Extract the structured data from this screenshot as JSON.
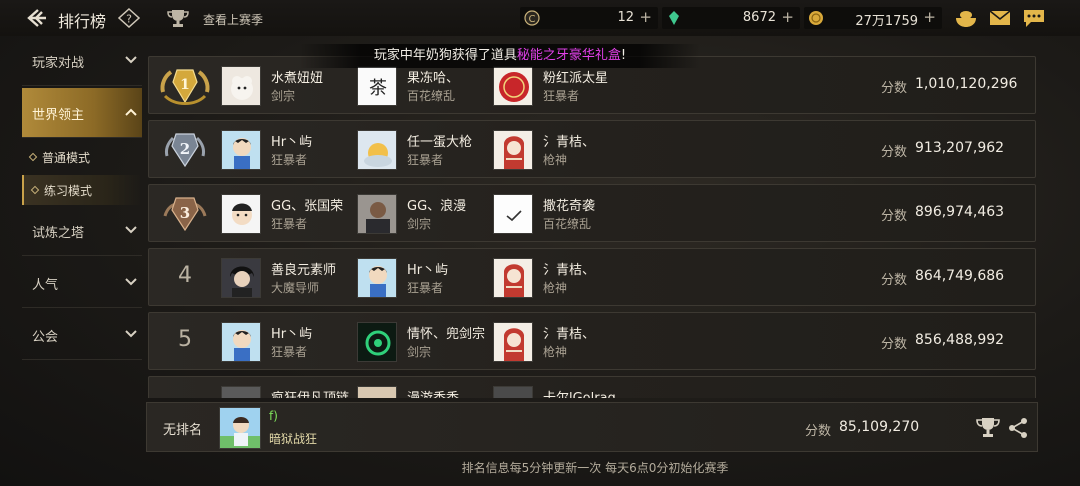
{
  "header": {
    "title": "排行榜",
    "prev_season": "查看上赛季",
    "currencies": [
      {
        "icon": "c-coin-icon",
        "value": "12",
        "color": "#c9b27a"
      },
      {
        "icon": "green-gem-icon",
        "value": "8672",
        "color": "#3fc88f"
      },
      {
        "icon": "gold-coin-icon",
        "value": "27万1759",
        "color": "#d9a93a"
      }
    ]
  },
  "sidebar": {
    "items": [
      {
        "label": "玩家对战"
      },
      {
        "label": "世界领主"
      },
      {
        "label": "试炼之塔"
      },
      {
        "label": "人气"
      },
      {
        "label": "公会"
      }
    ],
    "sub_items": [
      {
        "label": "普通模式"
      },
      {
        "label": "练习模式"
      }
    ]
  },
  "announcement": {
    "prefix": "玩家中年奶狗获得了道具",
    "item": "秘能之牙豪华礼盒",
    "suffix": "!",
    "item_color": "#e040e8"
  },
  "leaderboard": {
    "score_label": "分数",
    "rows": [
      {
        "rank": "1",
        "players": [
          {
            "name": "水煮妞妞",
            "class": "剑宗"
          },
          {
            "name": "果冻哈、",
            "class": "百花缭乱"
          },
          {
            "name": "粉红派太星",
            "class": "狂暴者"
          }
        ],
        "score": "1,010,120,296"
      },
      {
        "rank": "2",
        "players": [
          {
            "name": "Hr丶屿",
            "class": "狂暴者"
          },
          {
            "name": "任一蛋大枪",
            "class": "狂暴者"
          },
          {
            "name": "氵青桔、",
            "class": "枪神"
          }
        ],
        "score": "913,207,962"
      },
      {
        "rank": "3",
        "players": [
          {
            "name": "GG、张国荣",
            "class": "狂暴者"
          },
          {
            "name": "GG、浪漫",
            "class": "剑宗"
          },
          {
            "name": "撒花奇袭",
            "class": "百花缭乱"
          }
        ],
        "score": "896,974,463"
      },
      {
        "rank": "4",
        "players": [
          {
            "name": "善良元素师",
            "class": "大魔导师"
          },
          {
            "name": "Hr丶屿",
            "class": "狂暴者"
          },
          {
            "name": "氵青桔、",
            "class": "枪神"
          }
        ],
        "score": "864,749,686"
      },
      {
        "rank": "5",
        "players": [
          {
            "name": "Hr丶屿",
            "class": "狂暴者"
          },
          {
            "name": "情怀、兜剑宗",
            "class": "剑宗"
          },
          {
            "name": "氵青桔、",
            "class": "枪神"
          }
        ],
        "score": "856,488,992"
      },
      {
        "rank": "",
        "players": [
          {
            "name": "疯狂伊凡顶链",
            "class": ""
          },
          {
            "name": "漫游香香、",
            "class": ""
          },
          {
            "name": "卡尔lGolrag",
            "class": ""
          }
        ],
        "score": ""
      }
    ]
  },
  "own": {
    "rank_text": "无排名",
    "name": "f)",
    "class": "暗狱战狂",
    "score_label": "分数",
    "score": "85,109,270"
  },
  "footer": "排名信息每5分钟更新一次 每天6点0分初始化赛季"
}
